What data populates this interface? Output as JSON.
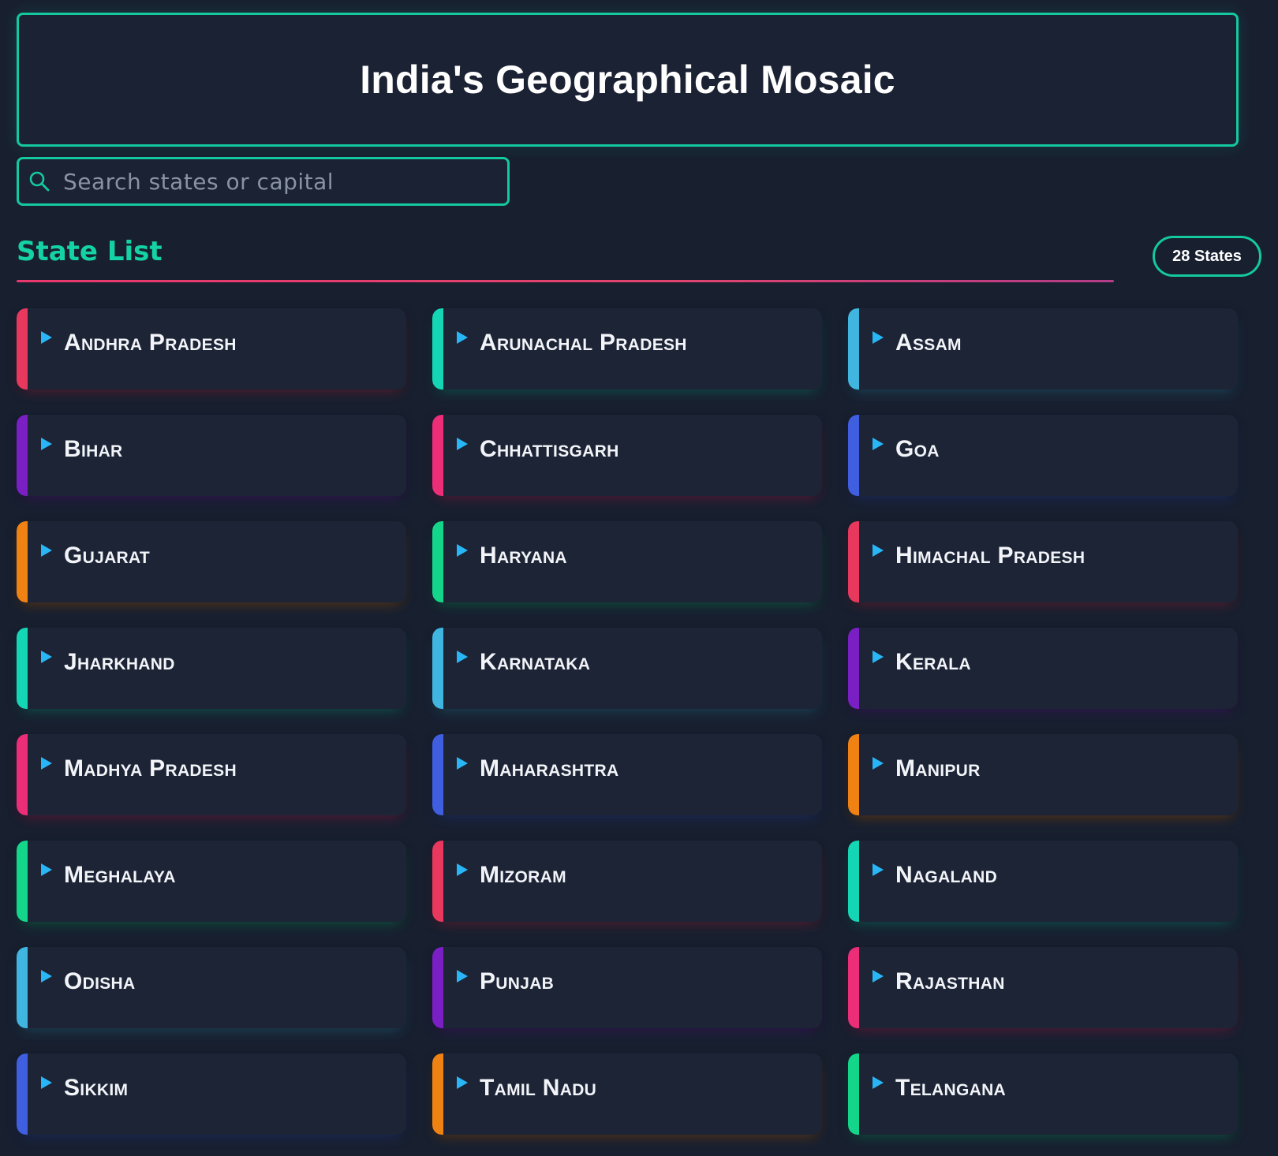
{
  "header": {
    "title": "India's Geographical Mosaic"
  },
  "search": {
    "placeholder": "Search states or capital",
    "value": ""
  },
  "state_list": {
    "title": "State List",
    "count_label": "28 States",
    "items": [
      {
        "label": "Andhra Pradesh",
        "accent": "#e8385e"
      },
      {
        "label": "Arunachal Pradesh",
        "accent": "#14d6b4"
      },
      {
        "label": "Assam",
        "accent": "#3fb5e0"
      },
      {
        "label": "Bihar",
        "accent": "#7a1fc4"
      },
      {
        "label": "Chhattisgarh",
        "accent": "#ec2d78"
      },
      {
        "label": "Goa",
        "accent": "#3f5ee0"
      },
      {
        "label": "Gujarat",
        "accent": "#f08214"
      },
      {
        "label": "Haryana",
        "accent": "#14d68a"
      },
      {
        "label": "Himachal Pradesh",
        "accent": "#e8385e"
      },
      {
        "label": "Jharkhand",
        "accent": "#14d6b4"
      },
      {
        "label": "Karnataka",
        "accent": "#3fb5e0"
      },
      {
        "label": "Kerala",
        "accent": "#7a1fc4"
      },
      {
        "label": "Madhya Pradesh",
        "accent": "#ec2d78"
      },
      {
        "label": "Maharashtra",
        "accent": "#3f5ee0"
      },
      {
        "label": "Manipur",
        "accent": "#f08214"
      },
      {
        "label": "Meghalaya",
        "accent": "#14d68a"
      },
      {
        "label": "Mizoram",
        "accent": "#e8385e"
      },
      {
        "label": "Nagaland",
        "accent": "#14d6b4"
      },
      {
        "label": "Odisha",
        "accent": "#3fb5e0"
      },
      {
        "label": "Punjab",
        "accent": "#7a1fc4"
      },
      {
        "label": "Rajasthan",
        "accent": "#ec2d78"
      },
      {
        "label": "Sikkim",
        "accent": "#3f5ee0"
      },
      {
        "label": "Tamil Nadu",
        "accent": "#f08214"
      },
      {
        "label": "Telangana",
        "accent": "#14d68a"
      }
    ]
  },
  "colors": {
    "background": "#182030",
    "brand_teal": "#14c8a0",
    "underline_pink": "#e8386d",
    "arrow_blue": "#29b6f6"
  },
  "icons": {
    "search": "search-icon",
    "card_marker": "play-arrow-icon"
  }
}
